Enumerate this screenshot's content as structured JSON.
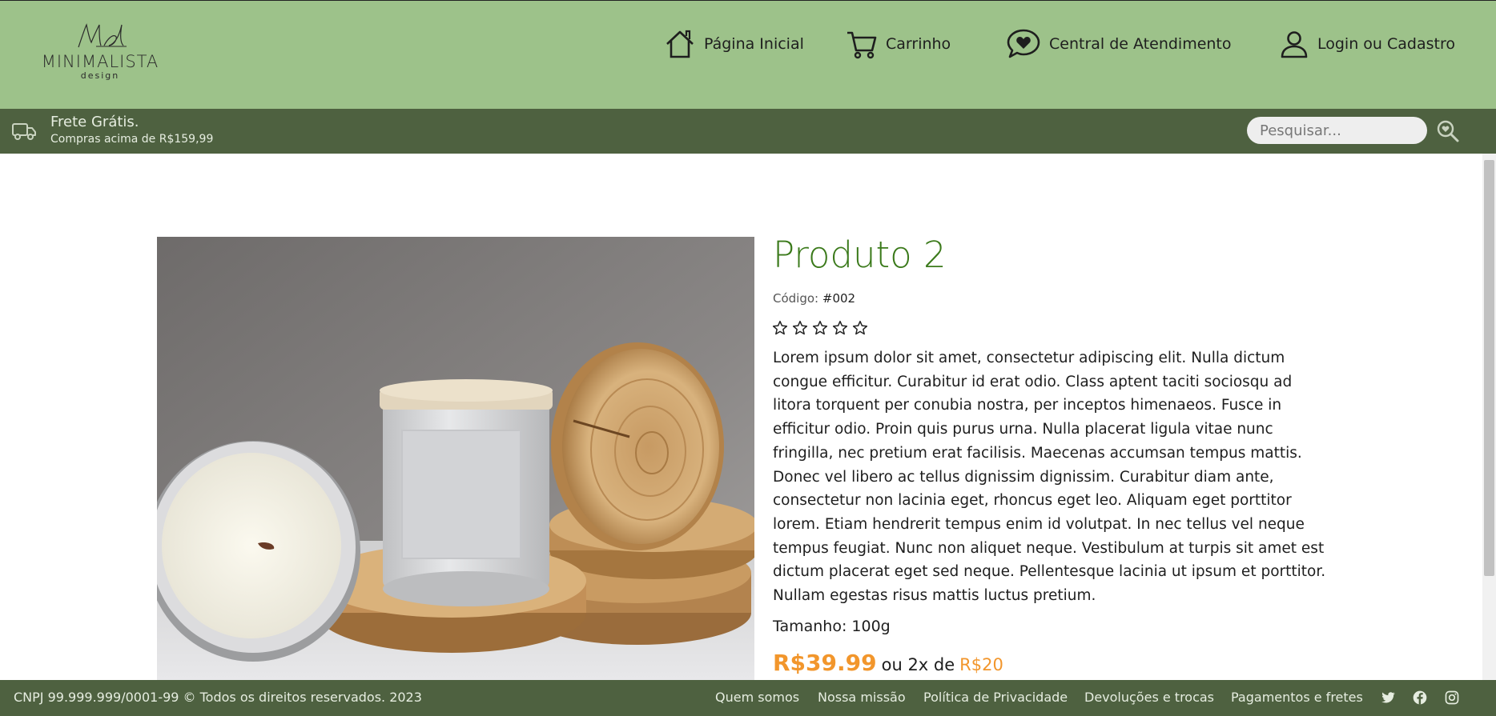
{
  "brand": {
    "logo_name": "MINIMALISTA",
    "logo_sub": "design"
  },
  "nav": {
    "home": "Página Inicial",
    "cart": "Carrinho",
    "support": "Central de Atendimento",
    "login": "Login ou Cadastro"
  },
  "shipping": {
    "title": "Frete Grátis.",
    "subtitle": "Compras acima de R$159,99"
  },
  "search": {
    "placeholder": "Pesquisar..."
  },
  "product": {
    "title": "Produto 2",
    "code_label": "Código:",
    "code_value": "#002",
    "rating": 0,
    "rating_max": 5,
    "description": "Lorem ipsum dolor sit amet, consectetur adipiscing elit. Nulla dictum congue efficitur. Curabitur id erat odio. Class aptent taciti sociosqu ad litora torquent per conubia nostra, per inceptos himenaeos. Fusce in efficitur odio. Proin quis purus urna. Nulla placerat ligula vitae nunc fringilla, nec pretium erat facilisis. Maecenas accumsan tempus mattis. Donec vel libero ac tellus dignissim dignissim. Curabitur diam ante, consectetur non lacinia eget, rhoncus eget leo. Aliquam eget porttitor lorem. Etiam hendrerit tempus enim id volutpat. In nec tellus vel neque tempus feugiat. Nunc non aliquet neque. Vestibulum at turpis sit amet est dictum placerat eget sed neque. Pellentesque lacinia ut ipsum et porttitor. Nullam egestas risus mattis luctus pretium.",
    "size": "Tamanho: 100g",
    "price": "R$39.99",
    "installment_text": "ou 2x de",
    "installment_price": "R$20"
  },
  "footer": {
    "copyright": "CNPJ 99.999.999/0001-99 © Todos os direitos reservados. 2023",
    "links": [
      "Quem somos",
      "Nossa missão",
      "Política de Privacidade",
      "Devoluções e trocas",
      "Pagamentos e fretes"
    ],
    "social": [
      "twitter-icon",
      "facebook-icon",
      "instagram-icon"
    ]
  },
  "colors": {
    "header_bg": "#9dc28a",
    "bar_bg": "#4e6140",
    "title_green": "#3b7a1b",
    "price_orange": "#f2962c"
  }
}
